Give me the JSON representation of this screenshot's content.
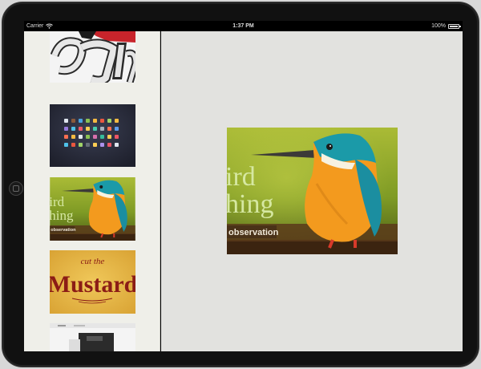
{
  "status_bar": {
    "carrier": "Carrier",
    "time": "1:37 PM",
    "battery": "100%"
  },
  "thumbnails": [
    {
      "name": "lettering",
      "label": ""
    },
    {
      "name": "icon-set",
      "label": ""
    },
    {
      "name": "kingfisher",
      "text_lines": [
        "ird",
        "hing"
      ],
      "tag": "observation"
    },
    {
      "name": "mustard",
      "line1": "cut the",
      "line2": "Mustard"
    },
    {
      "name": "website",
      "label": ""
    }
  ],
  "main_image": {
    "text_lines": [
      "ird",
      "hing"
    ],
    "tag": "observation"
  },
  "colors": {
    "sidebar_bg": "#efefe9",
    "main_bg": "#e2e2df",
    "mustard_bg": "#e3b645",
    "mustard_text": "#8b1c16",
    "icons_bg": "#2a2d3c"
  }
}
